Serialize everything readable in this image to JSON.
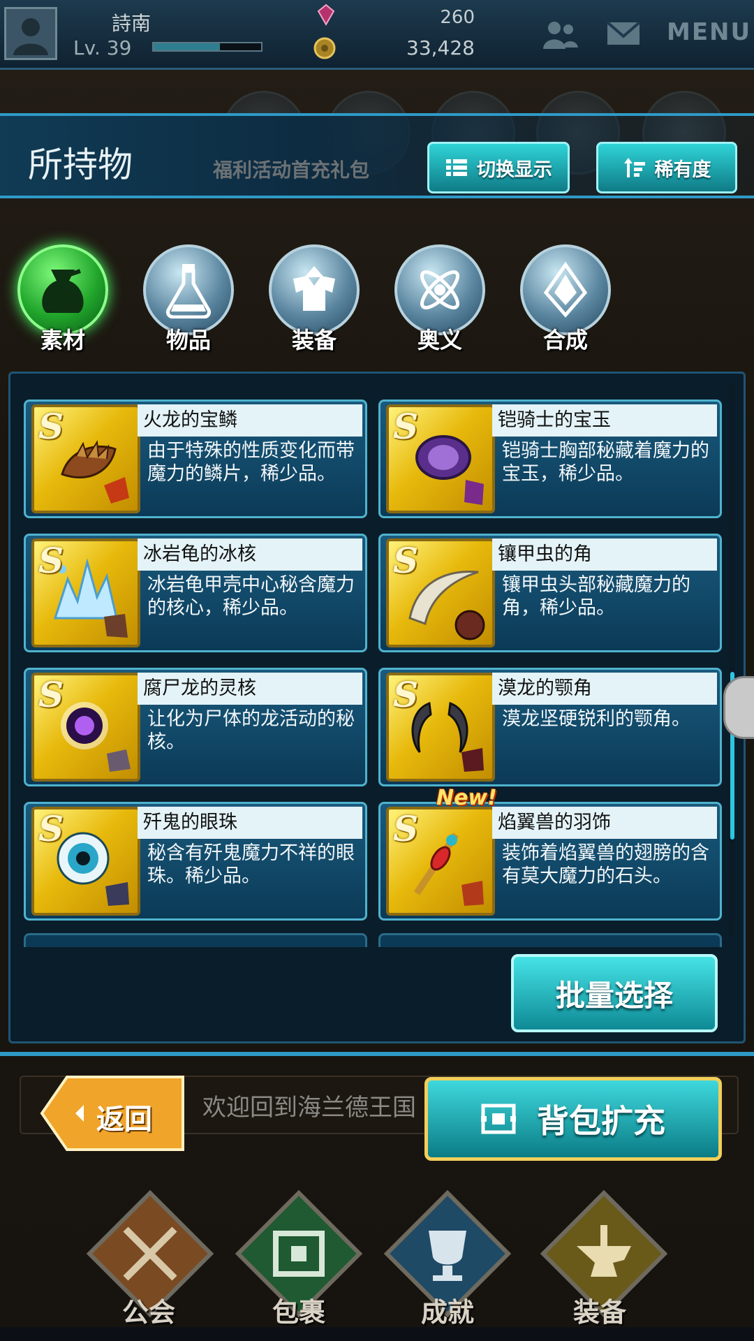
{
  "player": {
    "name": "詩南",
    "level": "Lv. 39",
    "xp_progress": 0.62
  },
  "currency": {
    "gems": "260",
    "coins": "33,428"
  },
  "header": {
    "menu": "MENU",
    "title": "所持物",
    "promo": "福利活动首充礼包",
    "switch_label": "切换显示",
    "rarity_label": "稀有度"
  },
  "tabs": [
    {
      "label": "素材",
      "icon": "bag-icon",
      "active": true
    },
    {
      "label": "物品",
      "icon": "potion-icon",
      "active": false
    },
    {
      "label": "装备",
      "icon": "armor-icon",
      "active": false
    },
    {
      "label": "奥义",
      "icon": "atom-icon",
      "active": false
    },
    {
      "label": "合成",
      "icon": "crystal-icon",
      "active": false
    }
  ],
  "items": [
    {
      "rank": "S",
      "name": "火龙的宝鳞",
      "desc": "由于特殊的性质变化而带魔力的鳞片，稀少品。",
      "icon": "scale-icon",
      "new": false
    },
    {
      "rank": "S",
      "name": "铠骑士的宝玉",
      "desc": "铠骑士胸部秘藏着魔力的宝玉，稀少品。",
      "icon": "gem-orb-icon",
      "new": false
    },
    {
      "rank": "S",
      "name": "冰岩龟的冰核",
      "desc": "冰岩龟甲壳中心秘含魔力的核心，稀少品。",
      "icon": "ice-core-icon",
      "new": false
    },
    {
      "rank": "S",
      "name": "镶甲虫的角",
      "desc": "镶甲虫头部秘藏魔力的角，稀少品。",
      "icon": "horn-icon",
      "new": false
    },
    {
      "rank": "S",
      "name": "腐尸龙的灵核",
      "desc": "让化为尸体的龙活动的秘核。",
      "icon": "spirit-core-icon",
      "new": false
    },
    {
      "rank": "S",
      "name": "漠龙的颚角",
      "desc": "漠龙坚硬锐利的颚角。",
      "icon": "jaw-horn-icon",
      "new": false
    },
    {
      "rank": "S",
      "name": "歼鬼的眼珠",
      "desc": "秘含有歼鬼魔力不祥的眼珠。稀少品。",
      "icon": "eyeball-icon",
      "new": false
    },
    {
      "rank": "S",
      "name": "焰翼兽的羽饰",
      "desc": "装饰着焰翼兽的翅膀的含有莫大魔力的石头。",
      "icon": "feather-ornament-icon",
      "new": true,
      "new_label": "New!"
    }
  ],
  "batch_label": "批量选择",
  "bottom": {
    "back": "返回",
    "ticker": "欢迎回到海兰德王国",
    "expand": "背包扩充"
  },
  "nav": [
    {
      "label": "公会",
      "icon": "crossed-swords-icon"
    },
    {
      "label": "包裹",
      "icon": "package-icon"
    },
    {
      "label": "成就",
      "icon": "trophy-icon"
    },
    {
      "label": "装备",
      "icon": "anvil-icon"
    }
  ],
  "colors": {
    "accent": "#2cc6e1",
    "button": "#1fb3bb",
    "gold": "#f2cf5a",
    "active_tab": "#21a52b"
  }
}
